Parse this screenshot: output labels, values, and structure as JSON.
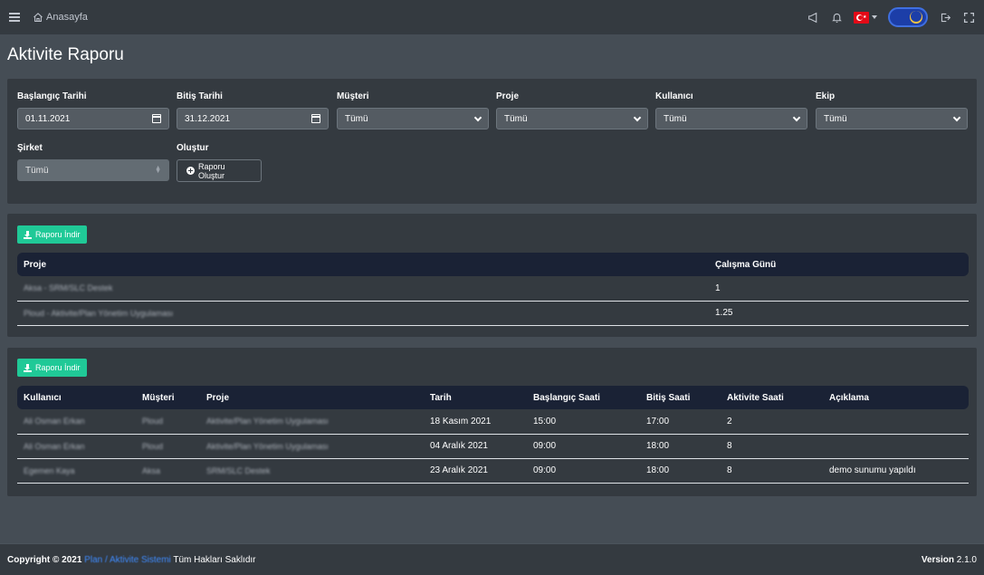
{
  "topbar": {
    "home_label": "Anasayfa",
    "icons": [
      "menu-icon",
      "home-icon",
      "megaphone-icon",
      "bell-icon",
      "turkish-flag-icon",
      "dark-mode-toggle",
      "logout-icon",
      "fullscreen-icon"
    ]
  },
  "page": {
    "title": "Aktivite Raporu"
  },
  "filters": {
    "start_date_label": "Başlangıç Tarihi",
    "start_date_value": "01.11.2021",
    "end_date_label": "Bitiş Tarihi",
    "end_date_value": "31.12.2021",
    "customer_label": "Müşteri",
    "customer_value": "Tümü",
    "project_label": "Proje",
    "project_value": "Tümü",
    "user_label": "Kullanıcı",
    "user_value": "Tümü",
    "team_label": "Ekip",
    "team_value": "Tümü",
    "company_label": "Şirket",
    "company_value": "Tümü",
    "create_label": "Oluştur",
    "create_button": "Raporu Oluştur"
  },
  "summary": {
    "download_button": "Raporu İndir",
    "headers": [
      "Proje",
      "Çalışma Günü"
    ],
    "rows": [
      [
        "Aksa - SRM/SLC Destek",
        "1"
      ],
      [
        "Ploud - Aktivite/Plan Yönetim Uygulaması",
        "1.25"
      ]
    ]
  },
  "detail": {
    "download_button": "Raporu İndir",
    "headers": [
      "Kullanıcı",
      "Müşteri",
      "Proje",
      "Tarih",
      "Başlangıç Saati",
      "Bitiş Saati",
      "Aktivite Saati",
      "Açıklama"
    ],
    "rows": [
      [
        "Ali Osman Erkan",
        "Ploud",
        "Aktivite/Plan Yönetim Uygulaması",
        "18 Kasım 2021",
        "15:00",
        "17:00",
        "2",
        ""
      ],
      [
        "Ali Osman Erkan",
        "Ploud",
        "Aktivite/Plan Yönetim Uygulaması",
        "04 Aralık 2021",
        "09:00",
        "18:00",
        "8",
        ""
      ],
      [
        "Egemen Kaya",
        "Aksa",
        "SRM/SLC Destek",
        "23 Aralık 2021",
        "09:00",
        "18:00",
        "8",
        "demo sunumu yapıldı"
      ]
    ]
  },
  "footer": {
    "copyright_prefix": "Copyright © 2021",
    "app_name": "Plan / Aktivite Sistemi",
    "rights": "Tüm Hakları Saklıdır",
    "version_label": "Version",
    "version_value": "2.1.0"
  },
  "colors": {
    "background": "#454d55",
    "panel": "#343a40",
    "table_header": "#1a2235",
    "accent_green": "#20c997",
    "link_blue": "#3f8cff",
    "flag_red": "#e30a17"
  }
}
